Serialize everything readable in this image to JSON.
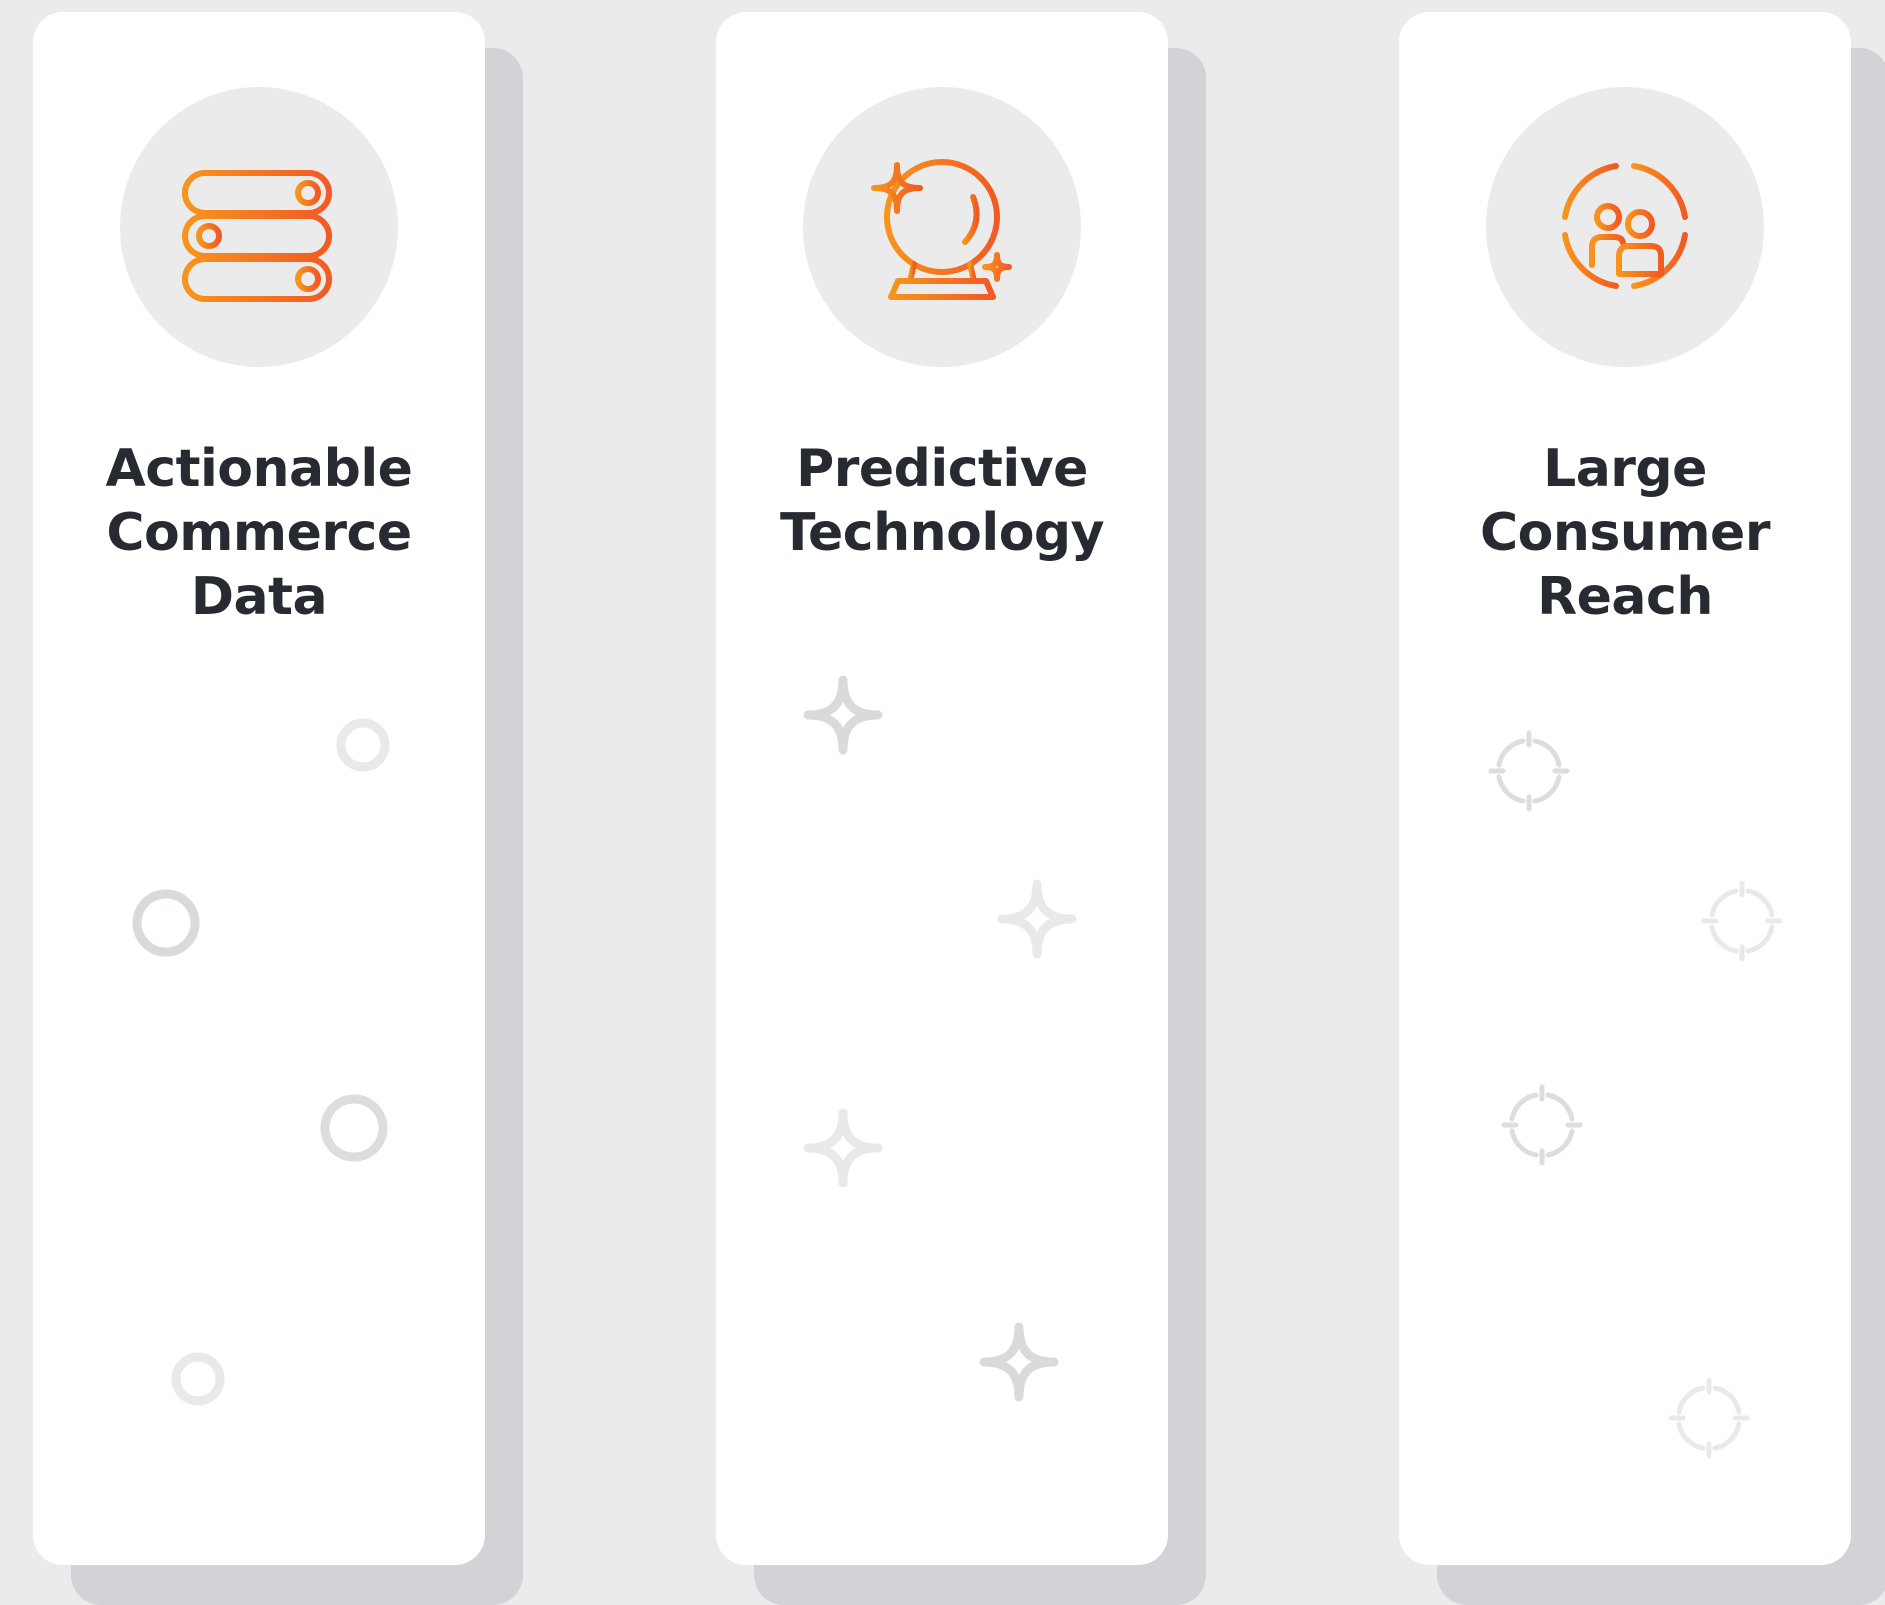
{
  "colors": {
    "background": "#eaebeb",
    "card": "#ffffff",
    "card_shadow": "#d2d3d6",
    "icon_circle": "#ebebeb",
    "accent_start": "#f7941d",
    "accent_end": "#f15a24",
    "title_text": "#272a30",
    "decor_dark": "#d9dadc",
    "decor_light": "#e8e9ea"
  },
  "cards": [
    {
      "icon": "database-server-icon",
      "title_lines": [
        "Actionable",
        "Commerce",
        "Data"
      ],
      "decor_icon": "ring-icon"
    },
    {
      "icon": "crystal-ball-icon",
      "title_lines": [
        "Predictive",
        "Technology"
      ],
      "decor_icon": "sparkle-icon"
    },
    {
      "icon": "target-audience-icon",
      "title_lines": [
        "Large",
        "Consumer",
        "Reach"
      ],
      "decor_icon": "crosshair-icon"
    }
  ]
}
